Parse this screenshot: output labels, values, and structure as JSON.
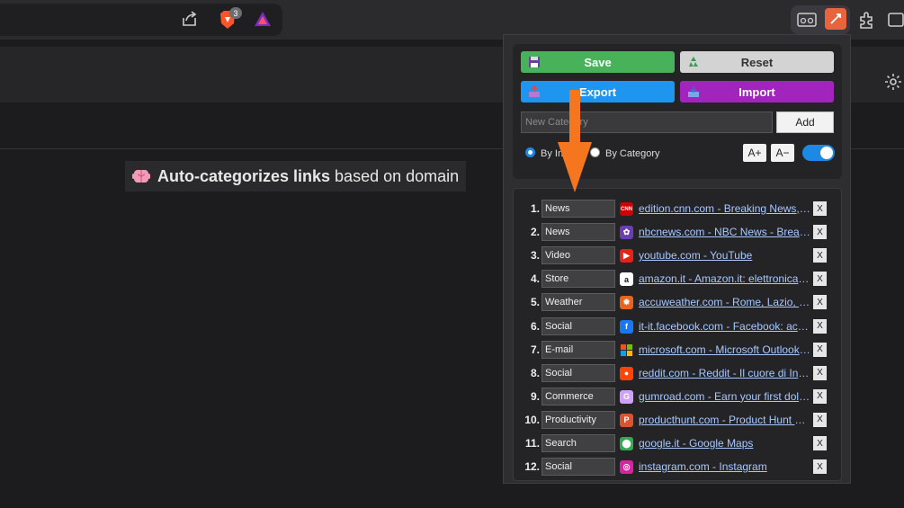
{
  "toolbar": {
    "brave_badge": "3"
  },
  "page": {
    "caption_bold": "Auto-categorizes links",
    "caption_rest": "based on domain"
  },
  "popup": {
    "buttons": {
      "save": "Save",
      "reset": "Reset",
      "export": "Export",
      "import": "Import",
      "add": "Add"
    },
    "category_placeholder": "New Category",
    "radio": {
      "inline": "By Inline",
      "category": "By Category"
    },
    "font_up": "A+",
    "font_down": "A−",
    "toggle_on": true,
    "delete_label": "X",
    "rows": [
      {
        "num": "1.",
        "category": "News",
        "link": "edition.cnn.com - Breaking News, Latest News and Videos",
        "favicon": "cnn-icon",
        "color": "#cc0000",
        "glyph": "CNN"
      },
      {
        "num": "2.",
        "category": "News",
        "link": "nbcnews.com - NBC News - Breaking News & Top Stories",
        "favicon": "nbc-peacock-icon",
        "color": "#6a3fb5",
        "glyph": "✿"
      },
      {
        "num": "3.",
        "category": "Video",
        "link": "youtube.com - YouTube",
        "favicon": "youtube-icon",
        "color": "#e62117",
        "glyph": "▶"
      },
      {
        "num": "4.",
        "category": "Store",
        "link": "amazon.it - Amazon.it: elettronica, libri, musica",
        "favicon": "amazon-icon",
        "color": "#ffffff",
        "glyph": "a"
      },
      {
        "num": "5.",
        "category": "Weather",
        "link": "accuweather.com - Rome, Lazio, Italy Weather",
        "favicon": "accuweather-sun-icon",
        "color": "#e8641c",
        "glyph": "✹"
      },
      {
        "num": "6.",
        "category": "Social",
        "link": "it-it.facebook.com - Facebook: accedi o iscriviti",
        "favicon": "facebook-icon",
        "color": "#1877f2",
        "glyph": "f"
      },
      {
        "num": "7.",
        "category": "E-mail",
        "link": "microsoft.com - Microsoft Outlook (formerly Hotmail)",
        "favicon": "microsoft-icon",
        "color": "#2b2b2e",
        "glyph": ""
      },
      {
        "num": "8.",
        "category": "Social",
        "link": "reddit.com - Reddit - Il cuore di Internet",
        "favicon": "reddit-icon",
        "color": "#ff4500",
        "glyph": "●"
      },
      {
        "num": "9.",
        "category": "Commerce",
        "link": "gumroad.com - Earn your first dollar online",
        "favicon": "gumroad-icon",
        "color": "#d0a0ff",
        "glyph": "G"
      },
      {
        "num": "10.",
        "category": "Productivity",
        "link": "producthunt.com - Product Hunt – The best new products",
        "favicon": "producthunt-icon",
        "color": "#da552f",
        "glyph": "P"
      },
      {
        "num": "11.",
        "category": "Search",
        "link": "google.it - Google Maps",
        "favicon": "google-maps-pin-icon",
        "color": "#34a853",
        "glyph": "⬤"
      },
      {
        "num": "12.",
        "category": "Social",
        "link": "instagram.com - Instagram",
        "favicon": "instagram-icon",
        "color": "#d6249f",
        "glyph": "◎"
      }
    ]
  }
}
